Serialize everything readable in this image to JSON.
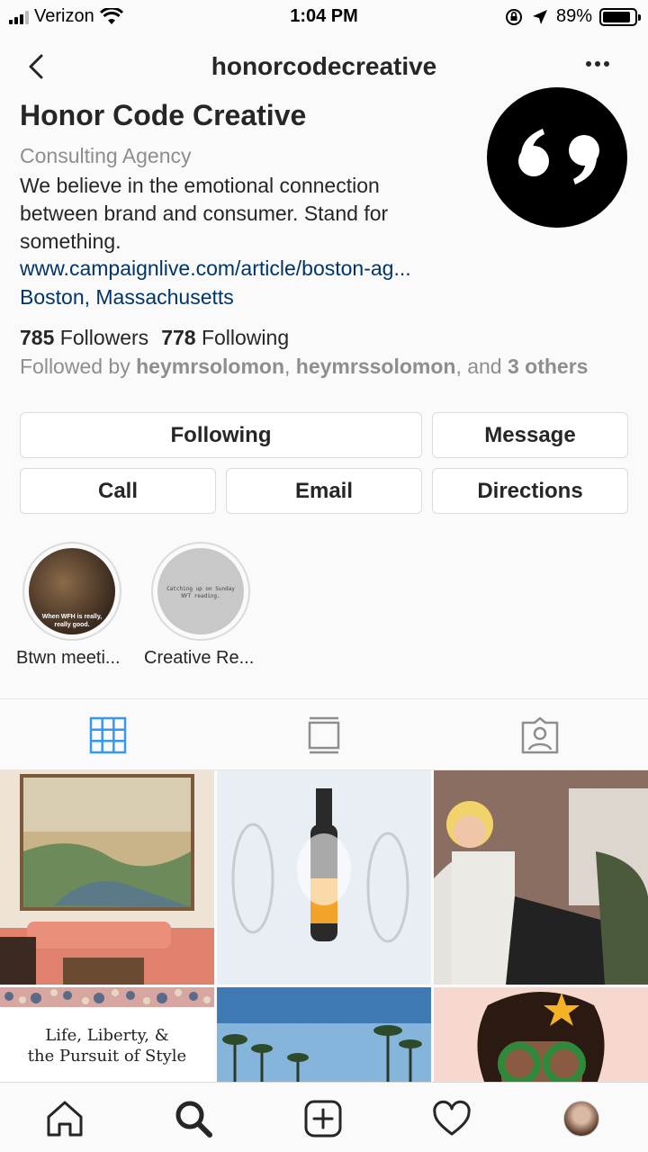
{
  "status_bar": {
    "carrier": "Verizon",
    "time": "1:04 PM",
    "battery_percent": "89%",
    "battery_level": 0.89,
    "icons": [
      "signal-icon",
      "wifi-icon",
      "orientation-lock-icon",
      "location-arrow-icon",
      "battery-icon"
    ]
  },
  "header": {
    "username": "honorcodecreative",
    "back_icon": "chevron-left-icon",
    "more_icon": "more-dots-icon"
  },
  "profile": {
    "name": "Honor Code Creative",
    "category": "Consulting Agency",
    "bio": "We believe in the emotional connection between brand and consumer. Stand for something.",
    "website": "www.campaignlive.com/article/boston-ag...",
    "location": "Boston, Massachusetts",
    "followers_count": "785",
    "followers_label": "Followers",
    "following_count": "778",
    "following_label": "Following",
    "followed_by_prefix": "Followed by",
    "followed_by_user1": "heymrsolomon",
    "followed_by_sep": ",",
    "followed_by_user2": "heymrssolomon",
    "followed_by_and": ", and",
    "followed_by_others": "3 others"
  },
  "buttons": {
    "following": "Following",
    "message": "Message",
    "call": "Call",
    "email": "Email",
    "directions": "Directions"
  },
  "highlights": [
    {
      "label": "Btwn meeti...",
      "caption": "When WFH is really, really good."
    },
    {
      "label": "Creative Re...",
      "caption": "Catching up on Sunday NYT reading."
    }
  ],
  "tabs": {
    "grid_icon": "grid-icon",
    "feed_icon": "feed-icon",
    "tagged_icon": "tagged-icon",
    "active": "grid",
    "active_color": "#3897f0"
  },
  "posts": {
    "tile4_text_line1": "Life, Liberty, &",
    "tile4_text_line2": "the Pursuit of Style"
  },
  "bottom_nav": {
    "icons": [
      "home-icon",
      "search-icon",
      "add-post-icon",
      "heart-icon",
      "profile-avatar"
    ]
  }
}
